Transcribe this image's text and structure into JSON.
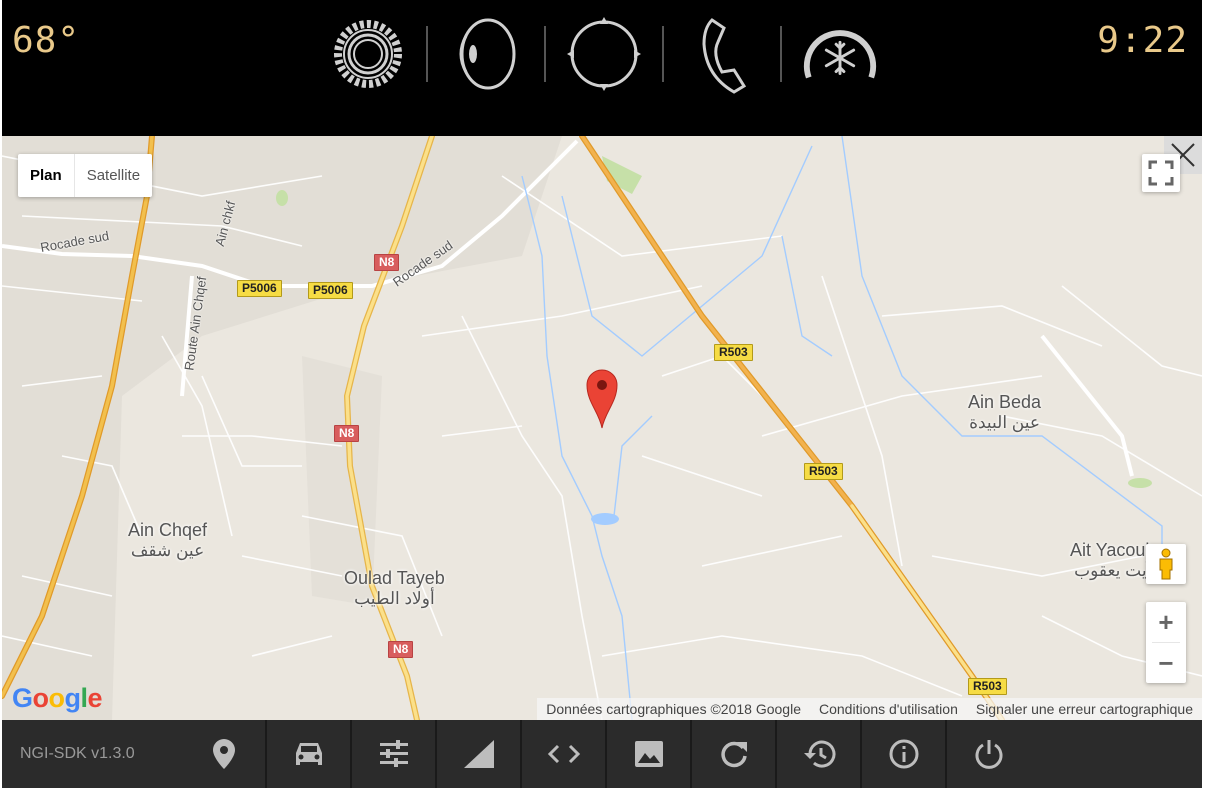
{
  "topbar": {
    "temperature": "68°",
    "time": "9:22",
    "icons": [
      "settings-gear-icon",
      "audio-speaker-icon",
      "navigation-compass-icon",
      "phone-icon",
      "climate-fan-icon"
    ]
  },
  "map": {
    "map_types": [
      "Plan",
      "Satellite"
    ],
    "selected_map_type": "Plan",
    "zoom_in": "+",
    "zoom_out": "−",
    "places": [
      {
        "name": "Ain Chqef",
        "arabic": "عين شقف"
      },
      {
        "name": "Oulad Tayeb",
        "arabic": "أولاد الطيب"
      },
      {
        "name": "Ain Beda",
        "arabic": "عين البيدة"
      },
      {
        "name": "Ait Yacoub",
        "arabic": "آيت يعقوب"
      }
    ],
    "road_labels": {
      "rocade1": "Rocade sud",
      "rocade2": "Rocade sud",
      "ainchkf": "Ain chkf",
      "route": "Route Ain Chqef"
    },
    "shields": {
      "p5006_a": "P5006",
      "p5006_b": "P5006",
      "n8_a": "N8",
      "n8_b": "N8",
      "n8_c": "N8",
      "r503_a": "R503",
      "r503_b": "R503",
      "r503_c": "R503"
    },
    "logo": "Google",
    "attribution": [
      "Données cartographiques ©2018 Google",
      "Conditions d'utilisation",
      "Signaler une erreur cartographique"
    ],
    "colors": {
      "land": "#ebe7df",
      "highway": "#f2c04e",
      "highway_edge": "#e09a2a",
      "water": "#a3ccff",
      "marker": "#ea4335"
    }
  },
  "bottombar": {
    "version": "NGI-SDK v1.3.0",
    "buttons": [
      "location-pin-icon",
      "car-icon",
      "tune-sliders-icon",
      "signal-icon",
      "code-icon",
      "image-icon",
      "refresh-icon",
      "history-icon",
      "info-icon",
      "power-icon"
    ]
  }
}
